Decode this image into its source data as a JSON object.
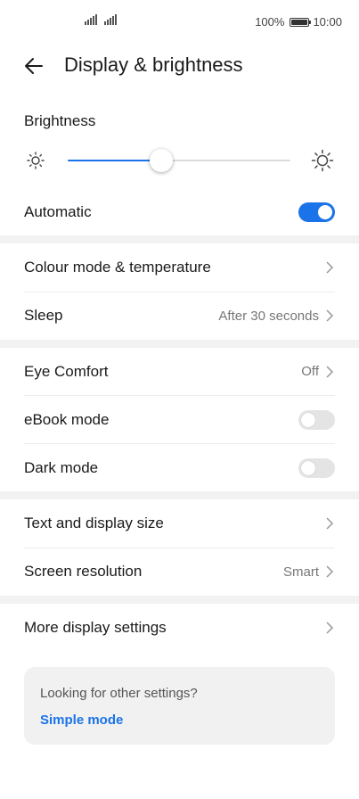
{
  "status_bar": {
    "battery_text": "100%",
    "time": "10:00"
  },
  "header": {
    "title": "Display & brightness"
  },
  "brightness": {
    "label": "Brightness",
    "level": 0.42
  },
  "automatic": {
    "label": "Automatic",
    "enabled": true
  },
  "colour_mode": {
    "label": "Colour mode & temperature"
  },
  "sleep": {
    "label": "Sleep",
    "value": "After 30 seconds"
  },
  "eye_comfort": {
    "label": "Eye Comfort",
    "value": "Off"
  },
  "ebook_mode": {
    "label": "eBook mode",
    "enabled": false
  },
  "dark_mode": {
    "label": "Dark mode",
    "enabled": false
  },
  "text_size": {
    "label": "Text and display size"
  },
  "resolution": {
    "label": "Screen resolution",
    "value": "Smart"
  },
  "more_settings": {
    "label": "More display settings"
  },
  "card": {
    "text": "Looking for other settings?",
    "link": "Simple mode"
  },
  "colors": {
    "accent": "#1a73e8",
    "toggle_off": "#e4e4e4",
    "section_gap": "#f2f2f2"
  }
}
